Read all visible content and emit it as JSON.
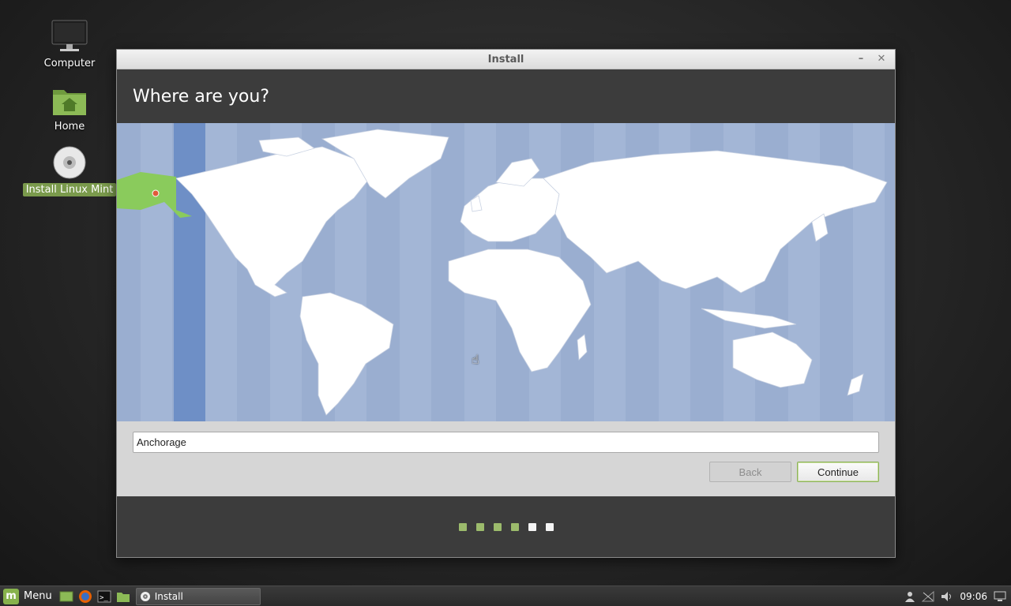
{
  "desktop": {
    "icons": [
      {
        "label": "Computer"
      },
      {
        "label": "Home"
      },
      {
        "label": "Install Linux Mint"
      }
    ]
  },
  "window": {
    "title": "Install",
    "minimize_glyph": "–",
    "close_glyph": "✕",
    "heading": "Where are you?",
    "timezone_value": "Anchorage",
    "back_label": "Back",
    "continue_label": "Continue",
    "progress": {
      "completed_steps": 4,
      "total_steps": 6
    }
  },
  "colors": {
    "map_ocean": "#9aaed0",
    "map_land": "#ffffff",
    "selected_zone_land": "#8acb5c",
    "selected_zone_band": "#6e8fc6",
    "accent": "#87b24c"
  },
  "taskbar": {
    "menu_label": "Menu",
    "task_label": "Install",
    "clock": "09:06",
    "quick_launch": [
      "show-desktop-icon",
      "firefox-icon",
      "terminal-icon",
      "files-icon"
    ],
    "tray": [
      "user-icon",
      "network-icon",
      "volume-icon",
      "display-icon"
    ]
  }
}
